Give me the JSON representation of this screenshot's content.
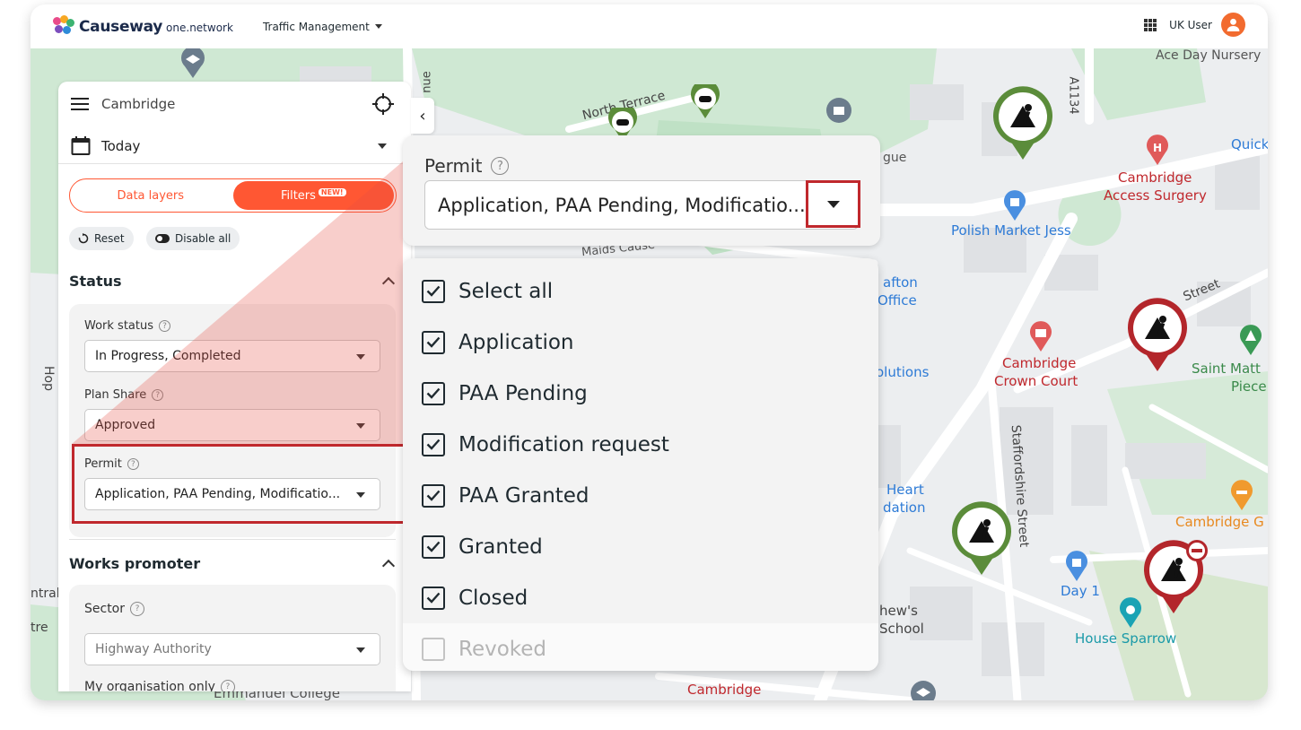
{
  "topbar": {
    "brand": "Causeway",
    "brand_sub": "one.network",
    "app_menu": "Traffic Management",
    "user": "UK User"
  },
  "map_labels": {
    "north_terrace": "North Terrace",
    "nue": "nue",
    "ace_day": "Ace Day Nursery",
    "a1134": "A1134",
    "quick": "Quick",
    "cambridge_access": "Cambridge",
    "access_surgery": "Access Surgery",
    "polish_market": "Polish Market Jess",
    "gue": "gue",
    "maids_cause": "Maids Cause",
    "afton": "afton",
    "office": "Office",
    "street": "Street",
    "solutions": "olutions",
    "cambridge_crown": "Cambridge",
    "crown_court": "Crown Court",
    "saint_matt": "Saint Matt",
    "piece": "Piece",
    "staffordshire": "Staffordshire Street",
    "heart": "Heart",
    "dation": "dation",
    "cambridge_g": "Cambridge G",
    "day1": "Day 1",
    "hews": "hew's",
    "school": "School",
    "house_sparrow": "House Sparrow",
    "cambridge_bottom": "Cambridge",
    "emmanuel": "Emmanuel College",
    "ntral": "ntral",
    "tre": "tre",
    "hop": "Hop"
  },
  "panel": {
    "location": "Cambridge",
    "date": "Today",
    "tab_data_layers": "Data layers",
    "tab_filters": "Filters",
    "new_badge": "NEW!",
    "reset": "Reset",
    "disable_all": "Disable all",
    "status_heading": "Status",
    "work_status_label": "Work status",
    "work_status_value": "In Progress, Completed",
    "plan_share_label": "Plan Share",
    "plan_share_value": "Approved",
    "permit_label": "Permit",
    "permit_value": "Application, PAA Pending, Modificatio...",
    "works_promoter_heading": "Works promoter",
    "sector_label": "Sector",
    "sector_value": "Highway Authority",
    "my_org_label": "My organisation only"
  },
  "zoom": {
    "permit_label": "Permit",
    "permit_value": "Application, PAA Pending, Modificatio..."
  },
  "dropdown": {
    "options": [
      {
        "label": "Select all",
        "checked": true
      },
      {
        "label": "Application",
        "checked": true
      },
      {
        "label": "PAA Pending",
        "checked": true
      },
      {
        "label": "Modification request",
        "checked": true
      },
      {
        "label": "PAA Granted",
        "checked": true
      },
      {
        "label": "Granted",
        "checked": true
      },
      {
        "label": "Closed",
        "checked": true
      },
      {
        "label": "Revoked",
        "checked": false
      }
    ]
  },
  "colors": {
    "accent": "#ff5733",
    "highlight": "#c0282d",
    "pin_green": "#5b8c3a",
    "pin_red": "#b3262b",
    "avatar": "#f26b2f"
  }
}
